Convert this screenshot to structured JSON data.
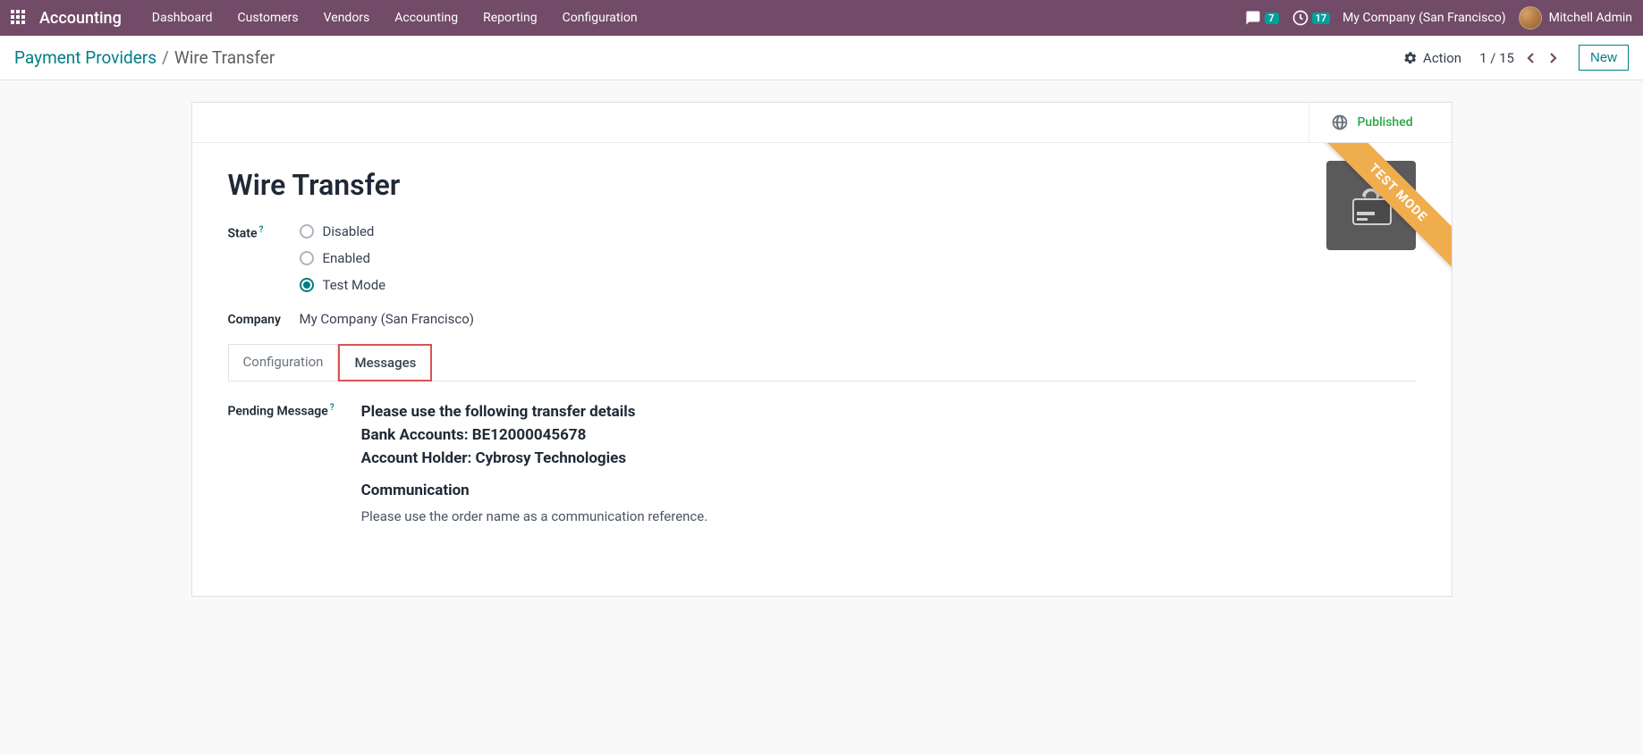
{
  "topbar": {
    "brand": "Accounting",
    "nav": [
      "Dashboard",
      "Customers",
      "Vendors",
      "Accounting",
      "Reporting",
      "Configuration"
    ],
    "messages_badge": "7",
    "activities_badge": "17",
    "company": "My Company (San Francisco)",
    "user": "Mitchell Admin"
  },
  "breadcrumb": {
    "parent": "Payment Providers",
    "current": "Wire Transfer"
  },
  "controls": {
    "action_label": "Action",
    "pager": "1 / 15",
    "new_label": "New"
  },
  "statbutton": {
    "published": "Published"
  },
  "record": {
    "title": "Wire Transfer",
    "state_label": "State",
    "state_options": {
      "disabled": "Disabled",
      "enabled": "Enabled",
      "test": "Test Mode"
    },
    "company_label": "Company",
    "company_value": "My Company (San Francisco)",
    "ribbon": "TEST MODE"
  },
  "tabs": {
    "configuration": "Configuration",
    "messages": "Messages"
  },
  "messages_tab": {
    "pending_label": "Pending Message",
    "line1": "Please use the following transfer details",
    "line2": "Bank Accounts: BE12000045678",
    "line3": "Account Holder: Cybrosy Technologies",
    "comm_heading": "Communication",
    "comm_text": "Please use the order name as a communication reference."
  }
}
